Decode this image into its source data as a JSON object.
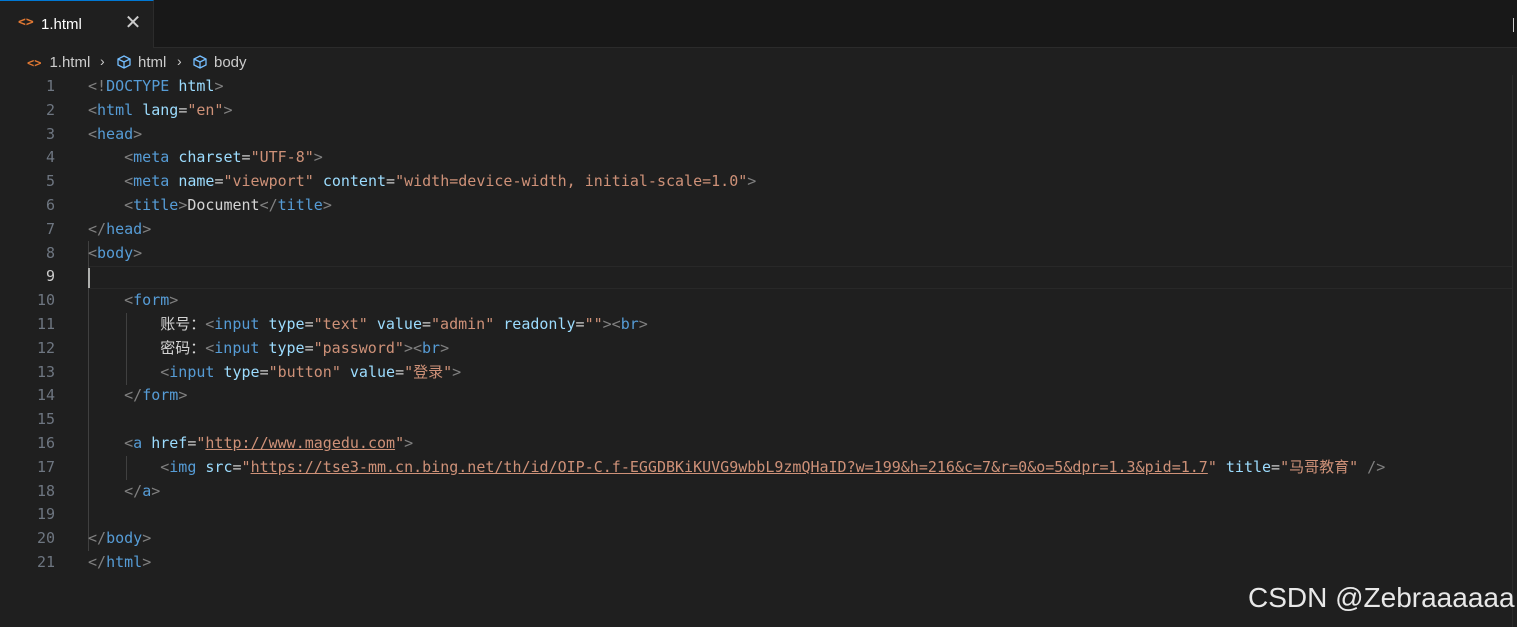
{
  "tab": {
    "icon": "<>",
    "label": "1.html",
    "close": "✕"
  },
  "breadcrumb": {
    "file": "1.html",
    "items": [
      "html",
      "body"
    ],
    "separator": "›"
  },
  "editor": {
    "active_line": 9,
    "lines": [
      {
        "n": "1",
        "tokens": [
          [
            "bracket",
            "<!"
          ],
          [
            "tag",
            "DOCTYPE"
          ],
          [
            "txt",
            " "
          ],
          [
            "attr",
            "html"
          ],
          [
            "bracket",
            ">"
          ]
        ]
      },
      {
        "n": "2",
        "tokens": [
          [
            "bracket",
            "<"
          ],
          [
            "tag",
            "html"
          ],
          [
            "txt",
            " "
          ],
          [
            "attr",
            "lang"
          ],
          [
            "eq",
            "="
          ],
          [
            "str",
            "\"en\""
          ],
          [
            "bracket",
            ">"
          ]
        ]
      },
      {
        "n": "3",
        "tokens": [
          [
            "bracket",
            "<"
          ],
          [
            "tag",
            "head"
          ],
          [
            "bracket",
            ">"
          ]
        ]
      },
      {
        "n": "4",
        "tokens": [
          [
            "txt",
            "    "
          ],
          [
            "bracket",
            "<"
          ],
          [
            "tag",
            "meta"
          ],
          [
            "txt",
            " "
          ],
          [
            "attr",
            "charset"
          ],
          [
            "eq",
            "="
          ],
          [
            "str",
            "\"UTF-8\""
          ],
          [
            "bracket",
            ">"
          ]
        ]
      },
      {
        "n": "5",
        "tokens": [
          [
            "txt",
            "    "
          ],
          [
            "bracket",
            "<"
          ],
          [
            "tag",
            "meta"
          ],
          [
            "txt",
            " "
          ],
          [
            "attr",
            "name"
          ],
          [
            "eq",
            "="
          ],
          [
            "str",
            "\"viewport\""
          ],
          [
            "txt",
            " "
          ],
          [
            "attr",
            "content"
          ],
          [
            "eq",
            "="
          ],
          [
            "str",
            "\"width=device-width, initial-scale=1.0\""
          ],
          [
            "bracket",
            ">"
          ]
        ]
      },
      {
        "n": "6",
        "tokens": [
          [
            "txt",
            "    "
          ],
          [
            "bracket",
            "<"
          ],
          [
            "tag",
            "title"
          ],
          [
            "bracket",
            ">"
          ],
          [
            "txt",
            "Document"
          ],
          [
            "bracket",
            "</"
          ],
          [
            "tag",
            "title"
          ],
          [
            "bracket",
            ">"
          ]
        ]
      },
      {
        "n": "7",
        "tokens": [
          [
            "bracket",
            "</"
          ],
          [
            "tag",
            "head"
          ],
          [
            "bracket",
            ">"
          ]
        ]
      },
      {
        "n": "8",
        "tokens": [
          [
            "bracket",
            "<"
          ],
          [
            "tag",
            "body"
          ],
          [
            "bracket",
            ">"
          ]
        ]
      },
      {
        "n": "9",
        "tokens": []
      },
      {
        "n": "10",
        "tokens": [
          [
            "txt",
            "    "
          ],
          [
            "bracket",
            "<"
          ],
          [
            "tag",
            "form"
          ],
          [
            "bracket",
            ">"
          ]
        ]
      },
      {
        "n": "11",
        "tokens": [
          [
            "txt",
            "        账号："
          ],
          [
            "bracket",
            "<"
          ],
          [
            "tag",
            "input"
          ],
          [
            "txt",
            " "
          ],
          [
            "attr",
            "type"
          ],
          [
            "eq",
            "="
          ],
          [
            "str",
            "\"text\""
          ],
          [
            "txt",
            " "
          ],
          [
            "attr",
            "value"
          ],
          [
            "eq",
            "="
          ],
          [
            "str",
            "\"admin\""
          ],
          [
            "txt",
            " "
          ],
          [
            "attr",
            "readonly"
          ],
          [
            "eq",
            "="
          ],
          [
            "str",
            "\"\""
          ],
          [
            "bracket",
            "><"
          ],
          [
            "tag",
            "br"
          ],
          [
            "bracket",
            ">"
          ]
        ]
      },
      {
        "n": "12",
        "tokens": [
          [
            "txt",
            "        密码："
          ],
          [
            "bracket",
            "<"
          ],
          [
            "tag",
            "input"
          ],
          [
            "txt",
            " "
          ],
          [
            "attr",
            "type"
          ],
          [
            "eq",
            "="
          ],
          [
            "str",
            "\"password\""
          ],
          [
            "bracket",
            "><"
          ],
          [
            "tag",
            "br"
          ],
          [
            "bracket",
            ">"
          ]
        ]
      },
      {
        "n": "13",
        "tokens": [
          [
            "txt",
            "        "
          ],
          [
            "bracket",
            "<"
          ],
          [
            "tag",
            "input"
          ],
          [
            "txt",
            " "
          ],
          [
            "attr",
            "type"
          ],
          [
            "eq",
            "="
          ],
          [
            "str",
            "\"button\""
          ],
          [
            "txt",
            " "
          ],
          [
            "attr",
            "value"
          ],
          [
            "eq",
            "="
          ],
          [
            "str",
            "\"登录\""
          ],
          [
            "bracket",
            ">"
          ]
        ]
      },
      {
        "n": "14",
        "tokens": [
          [
            "txt",
            "    "
          ],
          [
            "bracket",
            "</"
          ],
          [
            "tag",
            "form"
          ],
          [
            "bracket",
            ">"
          ]
        ]
      },
      {
        "n": "15",
        "tokens": []
      },
      {
        "n": "16",
        "tokens": [
          [
            "txt",
            "    "
          ],
          [
            "bracket",
            "<"
          ],
          [
            "tag",
            "a"
          ],
          [
            "txt",
            " "
          ],
          [
            "attr",
            "href"
          ],
          [
            "eq",
            "="
          ],
          [
            "str",
            "\""
          ],
          [
            "strlink",
            "http://www.magedu.com"
          ],
          [
            "str",
            "\""
          ],
          [
            "bracket",
            ">"
          ]
        ]
      },
      {
        "n": "17",
        "tokens": [
          [
            "txt",
            "        "
          ],
          [
            "bracket",
            "<"
          ],
          [
            "tag",
            "img"
          ],
          [
            "txt",
            " "
          ],
          [
            "attr",
            "src"
          ],
          [
            "eq",
            "="
          ],
          [
            "str",
            "\""
          ],
          [
            "strlink",
            "https://tse3-mm.cn.bing.net/th/id/OIP-C.f-EGGDBKiKUVG9wbbL9zmQHaID?w=199&h=216&c=7&r=0&o=5&dpr=1.3&pid=1.7"
          ],
          [
            "str",
            "\""
          ],
          [
            "txt",
            " "
          ],
          [
            "attr",
            "title"
          ],
          [
            "eq",
            "="
          ],
          [
            "str",
            "\"马哥教育\""
          ],
          [
            "txt",
            " "
          ],
          [
            "bracket",
            "/>"
          ]
        ]
      },
      {
        "n": "18",
        "tokens": [
          [
            "txt",
            "    "
          ],
          [
            "bracket",
            "</"
          ],
          [
            "tag",
            "a"
          ],
          [
            "bracket",
            ">"
          ]
        ]
      },
      {
        "n": "19",
        "tokens": []
      },
      {
        "n": "20",
        "tokens": [
          [
            "bracket",
            "</"
          ],
          [
            "tag",
            "body"
          ],
          [
            "bracket",
            ">"
          ]
        ]
      },
      {
        "n": "21",
        "tokens": [
          [
            "bracket",
            "</"
          ],
          [
            "tag",
            "html"
          ],
          [
            "bracket",
            ">"
          ]
        ]
      }
    ]
  },
  "watermark": "CSDN @Zebraaaaaa",
  "colors": {
    "tag": "#569cd6",
    "attribute": "#9cdcfe",
    "string": "#ce9178",
    "bracket": "#808080",
    "file_icon": "#e37933",
    "active_tab_border": "#0078d4"
  }
}
